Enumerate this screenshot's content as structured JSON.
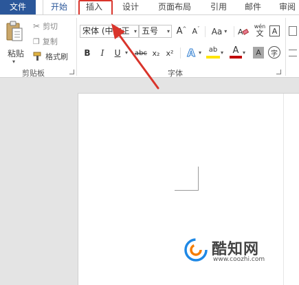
{
  "tabs": {
    "file": "文件",
    "home": "开始",
    "insert": "插入",
    "design": "设计",
    "layout": "页面布局",
    "references": "引用",
    "mailings": "邮件",
    "review": "审阅"
  },
  "clipboard": {
    "paste": "粘贴",
    "cut": "剪切",
    "copy": "复制",
    "format_painter": "格式刷",
    "group_label": "剪贴板"
  },
  "font": {
    "font_name": "宋体 (中文正",
    "font_size": "五号",
    "grow": "A",
    "shrink": "A",
    "change_case": "Aa",
    "phonetic_top": "wén",
    "phonetic_bottom": "文",
    "border_char": "A",
    "bold": "B",
    "italic": "I",
    "underline": "U",
    "strikethrough": "abc",
    "subscript": "x₂",
    "superscript": "x²",
    "text_effects": "A",
    "highlight": "ab",
    "font_color": "A",
    "char_shading": "A",
    "enclose": "字",
    "group_label": "字体"
  },
  "colors": {
    "brand": "#2b579a",
    "highlight_annotation": "#d9342b",
    "highlight_yellow": "#ffe400",
    "font_red": "#c00000"
  },
  "watermark": {
    "brand": "酷知网",
    "url": "www.coozhi.com"
  }
}
